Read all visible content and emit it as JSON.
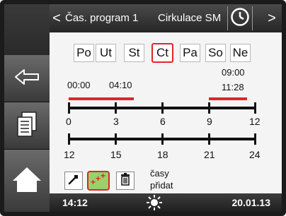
{
  "header": {
    "prev_arrow": "<",
    "title": "Čas. program 1",
    "subtitle": "Cirkulace SM",
    "next_arrow": ">"
  },
  "days": [
    {
      "label": "Po",
      "active": false
    },
    {
      "label": "Ut",
      "active": false
    },
    {
      "label": "St",
      "active": false
    },
    {
      "label": "Ct",
      "active": true
    },
    {
      "label": "Pa",
      "active": false
    },
    {
      "label": "So",
      "active": false
    },
    {
      "label": "Ne",
      "active": false
    }
  ],
  "schedule": {
    "period1_start": "00:00",
    "period1_end": "04:10",
    "period2_start": "09:00",
    "period2_end": "11:28",
    "axis1_ticks": [
      "0",
      "3",
      "6",
      "9",
      "12"
    ],
    "axis2_ticks": [
      "12",
      "15",
      "18",
      "21",
      "24"
    ],
    "segments_hours": [
      [
        0,
        4.17
      ],
      [
        9,
        11.47
      ]
    ]
  },
  "tools": {
    "add_text_line1": "časy",
    "add_text_line2": "přidat"
  },
  "footer": {
    "time": "14:12",
    "date": "20.01.13"
  },
  "colors": {
    "accent_red": "#e0242b",
    "active_green": "#9bd06a"
  }
}
